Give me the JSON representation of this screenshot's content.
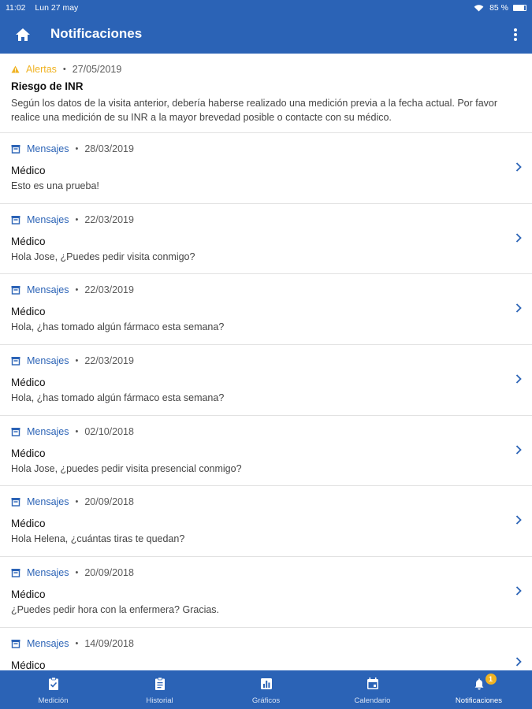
{
  "status_bar": {
    "time": "11:02",
    "date": "Lun 27 may",
    "battery": "85 %",
    "battery_level": 0.85
  },
  "app_bar": {
    "title": "Notificaciones"
  },
  "alert": {
    "category": "Alertas",
    "date": "27/05/2019",
    "title": "Riesgo de INR",
    "body": "Según los datos de la visita anterior, debería haberse realizado una medición previa a la fecha actual. Por favor realice una medición de su INR a la mayor brevedad posible o contacte con su médico."
  },
  "messages": [
    {
      "category": "Mensajes",
      "date": "28/03/2019",
      "sender": "Médico",
      "text": "Esto es una prueba!"
    },
    {
      "category": "Mensajes",
      "date": "22/03/2019",
      "sender": "Médico",
      "text": "Hola Jose, ¿Puedes pedir visita conmigo?"
    },
    {
      "category": "Mensajes",
      "date": "22/03/2019",
      "sender": "Médico",
      "text": "Hola, ¿has tomado algún fármaco esta semana?"
    },
    {
      "category": "Mensajes",
      "date": "22/03/2019",
      "sender": "Médico",
      "text": "Hola, ¿has tomado algún fármaco esta semana?"
    },
    {
      "category": "Mensajes",
      "date": "02/10/2018",
      "sender": "Médico",
      "text": "Hola Jose, ¿puedes pedir visita presencial conmigo?"
    },
    {
      "category": "Mensajes",
      "date": "20/09/2018",
      "sender": "Médico",
      "text": "Hola Helena, ¿cuántas tiras te quedan?"
    },
    {
      "category": "Mensajes",
      "date": "20/09/2018",
      "sender": "Médico",
      "text": "¿Puedes pedir hora con la enfermera? Gracias."
    },
    {
      "category": "Mensajes",
      "date": "14/09/2018",
      "sender": "Médico",
      "text": ""
    }
  ],
  "bottom_nav": {
    "items": [
      {
        "label": "Medición",
        "icon": "clipboard-check-icon"
      },
      {
        "label": "Historial",
        "icon": "clipboard-list-icon"
      },
      {
        "label": "Gráficos",
        "icon": "bar-chart-icon"
      },
      {
        "label": "Calendario",
        "icon": "calendar-icon"
      },
      {
        "label": "Notificaciones",
        "icon": "bell-icon",
        "active": true,
        "badge": "1"
      }
    ]
  },
  "colors": {
    "primary": "#2b63b6",
    "alert": "#f0b323",
    "badge": "#f0b323"
  }
}
